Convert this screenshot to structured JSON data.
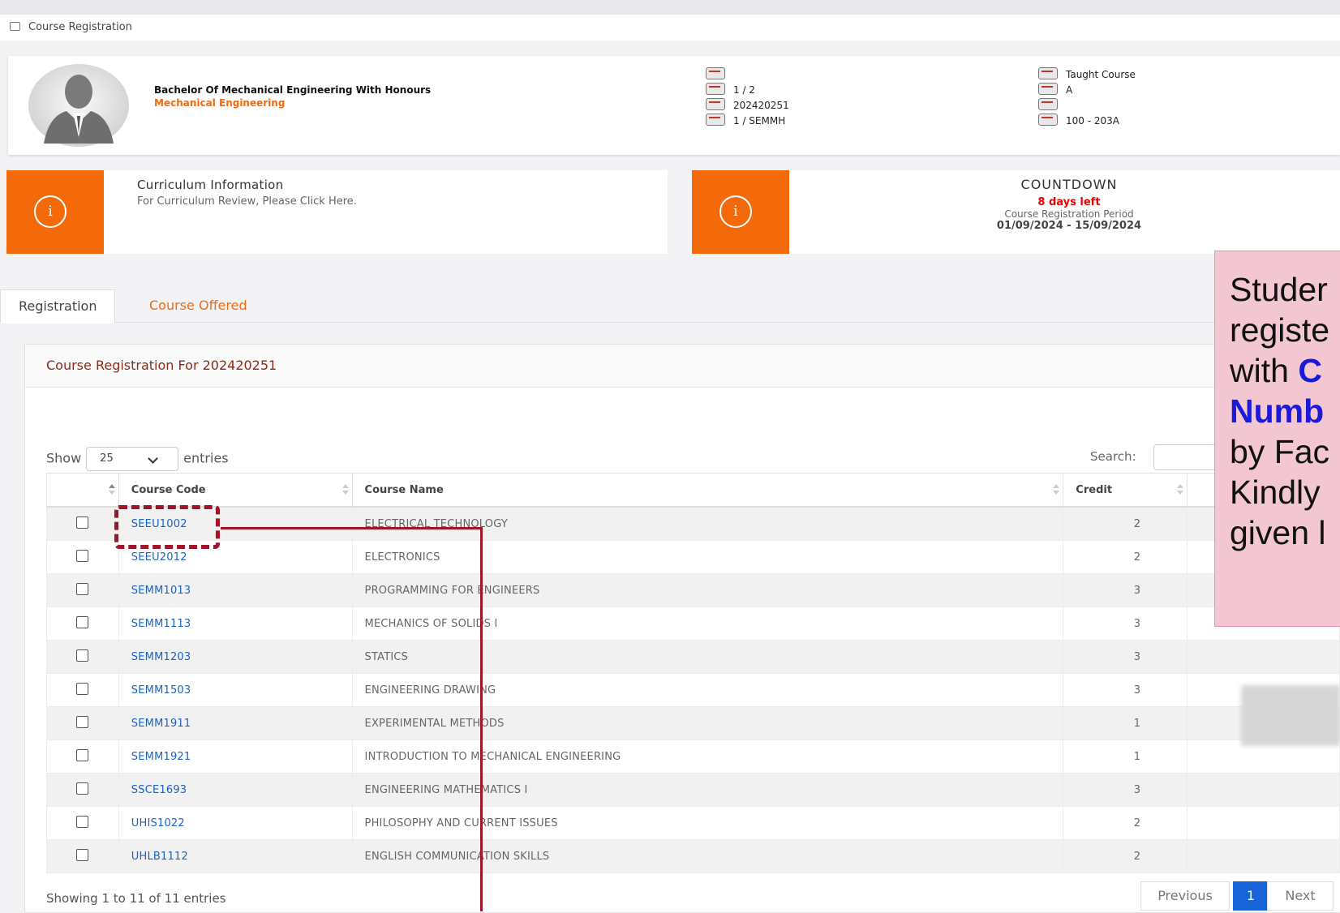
{
  "breadcrumb": {
    "label": "Course Registration"
  },
  "profile": {
    "programme": "Bachelor Of Mechanical Engineering With Honours",
    "faculty": "Mechanical Engineering",
    "col1": [
      "",
      "1 / 2",
      "202420251",
      "1 / SEMMH"
    ],
    "col2": [
      "Taught Course",
      "A",
      "",
      "100 - 203A"
    ]
  },
  "curriculum": {
    "title": "Curriculum Information",
    "subtitle": "For Curriculum Review, Please Click Here.",
    "icon": "info-icon"
  },
  "countdown": {
    "title": "COUNTDOWN",
    "days_left": "8 days left",
    "period_label": "Course Registration Period",
    "period": "01/09/2024 - 15/09/2024"
  },
  "tabs": [
    {
      "label": "Registration",
      "active": true
    },
    {
      "label": "Course Offered",
      "active": false
    }
  ],
  "panel": {
    "title": "Course Registration For 202420251",
    "show_label": "Show",
    "entries_value": "25",
    "entries_label": "entries",
    "search_label": "Search:"
  },
  "table": {
    "headers": [
      "Course Code",
      "Course Name",
      "Credit"
    ],
    "rows": [
      {
        "code": "SEEU1002",
        "name": "ELECTRICAL TECHNOLOGY",
        "credit": "2"
      },
      {
        "code": "SEEU2012",
        "name": "ELECTRONICS",
        "credit": "2"
      },
      {
        "code": "SEMM1013",
        "name": "PROGRAMMING FOR ENGINEERS",
        "credit": "3"
      },
      {
        "code": "SEMM1113",
        "name": "MECHANICS OF SOLIDS I",
        "credit": "3"
      },
      {
        "code": "SEMM1203",
        "name": "STATICS",
        "credit": "3"
      },
      {
        "code": "SEMM1503",
        "name": "ENGINEERING DRAWING",
        "credit": "3"
      },
      {
        "code": "SEMM1911",
        "name": "EXPERIMENTAL METHODS",
        "credit": "1"
      },
      {
        "code": "SEMM1921",
        "name": "INTRODUCTION TO MECHANICAL ENGINEERING",
        "credit": "1"
      },
      {
        "code": "SSCE1693",
        "name": "ENGINEERING MATHEMATICS I",
        "credit": "3"
      },
      {
        "code": "UHIS1022",
        "name": "PHILOSOPHY AND CURRENT ISSUES",
        "credit": "2"
      },
      {
        "code": "UHLB1112",
        "name": "ENGLISH COMMUNICATION SKILLS",
        "credit": "2"
      }
    ],
    "info": "Showing 1 to 11 of 11 entries"
  },
  "pagination": {
    "previous": "Previous",
    "current": "1",
    "next": "Next"
  },
  "annotation": {
    "l1": "Studer",
    "l2": "registe",
    "l3a": "with ",
    "l3b": "C",
    "l4": "Numb",
    "l5": "by Fac",
    "l6": "Kindly",
    "l7": "given l"
  },
  "colors": {
    "accent": "#f46a0a",
    "link": "#1a63c4",
    "highlight": "#a0152a",
    "note_bg": "#f2c7d2"
  }
}
